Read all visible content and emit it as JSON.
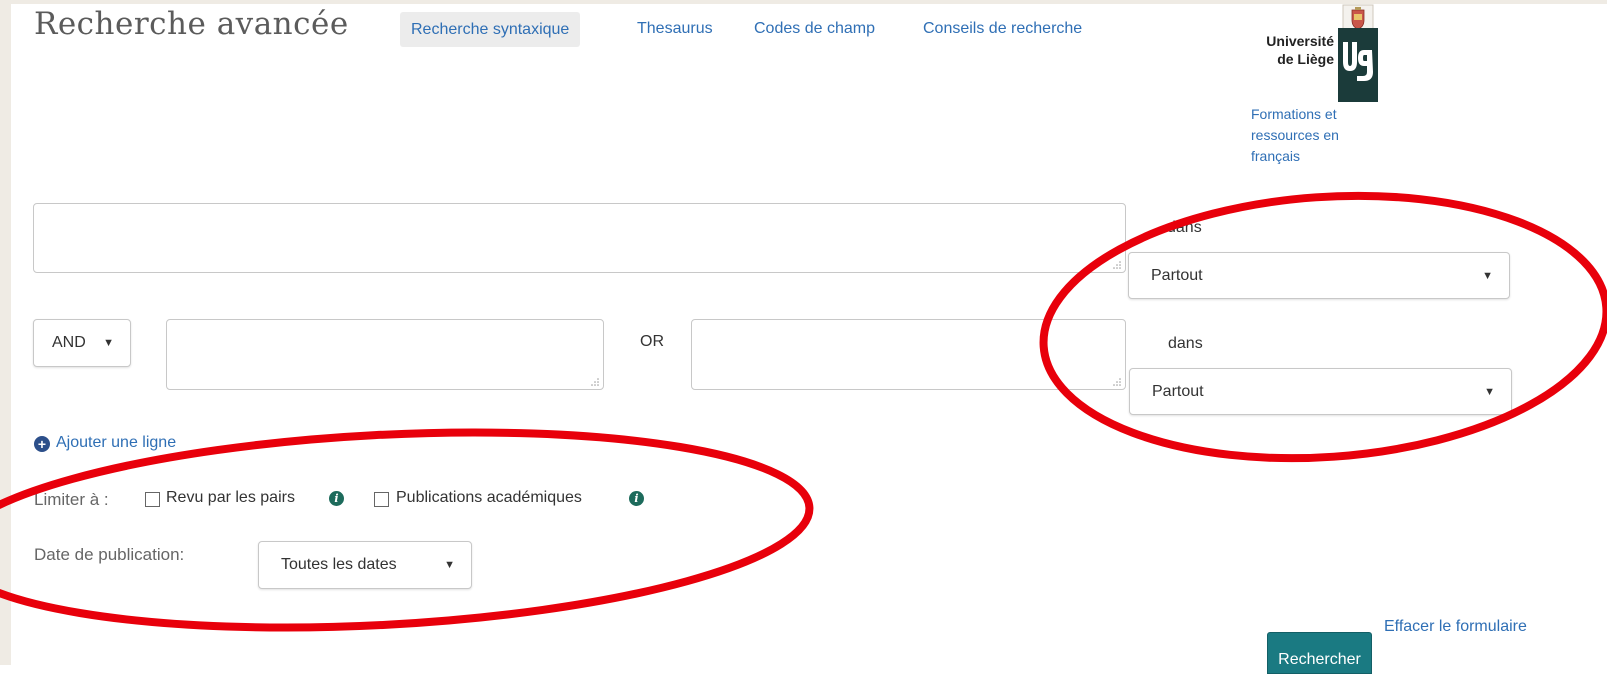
{
  "header": {
    "title": "Recherche avancée",
    "tabs": [
      {
        "label": "Recherche syntaxique"
      },
      {
        "label": "Thesaurus"
      },
      {
        "label": "Codes de champ"
      },
      {
        "label": "Conseils de recherche"
      }
    ]
  },
  "logo": {
    "line1": "Université",
    "line2": "de Liège",
    "caption": "Formations et ressources en français"
  },
  "rows": {
    "row1": {
      "dans_label": "dans",
      "field_select": "Partout"
    },
    "row2": {
      "operator": "AND",
      "or_label": "OR",
      "dans_label": "dans",
      "field_select": "Partout"
    }
  },
  "add_line": {
    "icon": "plus-circle-icon",
    "label": "Ajouter une ligne"
  },
  "limits": {
    "label": "Limiter à :",
    "options": [
      {
        "label": "Revu par les pairs",
        "checked": false
      },
      {
        "label": "Publications académiques",
        "checked": false
      }
    ]
  },
  "date": {
    "label": "Date de publication:",
    "value": "Toutes les dates"
  },
  "actions": {
    "search": "Rechercher",
    "clear": "Effacer le formulaire"
  },
  "colors": {
    "link": "#2f6fb5",
    "button": "#1a7a82",
    "annotation": "#e8000b",
    "info_icon": "#1d6b5c"
  }
}
